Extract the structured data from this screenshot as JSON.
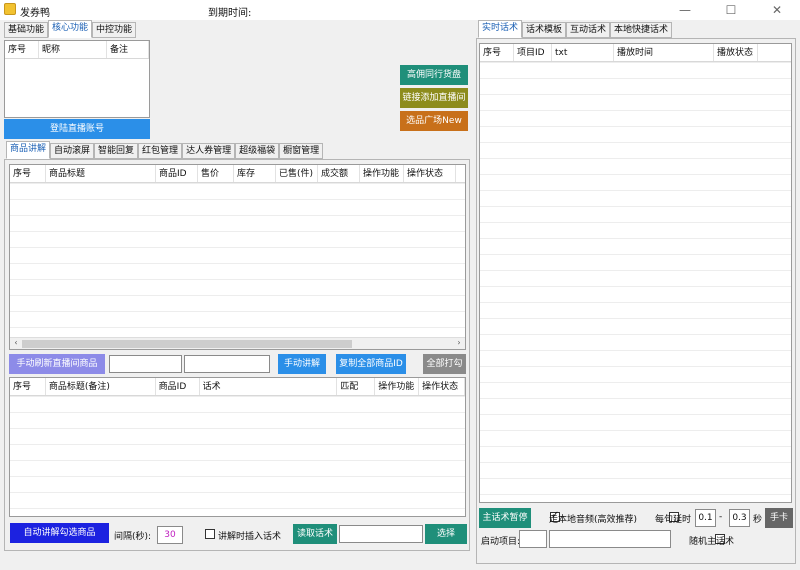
{
  "window": {
    "title": "发券鸭",
    "expire_label": "到期时间:"
  },
  "left_top_tabs": [
    "基础功能",
    "核心功能",
    "中控功能"
  ],
  "account_table": {
    "columns": [
      "序号",
      "昵称",
      "备注"
    ]
  },
  "login_button": "登陆直播账号",
  "side_buttons": {
    "b1": "高佣同行货盘",
    "b2": "链接添加直播间",
    "b3": "选品广场New"
  },
  "feature_tabs": [
    "商品讲解",
    "自动滚屏",
    "智能回复",
    "红包管理",
    "达人券管理",
    "超级福袋",
    "橱窗管理"
  ],
  "product_table": {
    "columns": [
      "序号",
      "商品标题",
      "商品ID",
      "售价",
      "库存",
      "已售(件)",
      "成交额",
      "操作功能",
      "操作状态"
    ]
  },
  "mid_controls": {
    "refresh": "手动刷新直播间商品",
    "input1": "",
    "input2": "",
    "manual_explain": "手动讲解",
    "copy_ids": "复制全部商品ID",
    "print_all": "全部打勾"
  },
  "script_table": {
    "columns": [
      "序号",
      "商品标题(备注)",
      "商品ID",
      "话术",
      "匹配",
      "操作功能",
      "操作状态"
    ]
  },
  "bottom_controls": {
    "auto_explain": "自动讲解勾选商品",
    "interval_label": "间隔(秒):",
    "interval_value": "30",
    "insert_label": "讲解时插入话术",
    "read_script": "读取话术",
    "read_input": "",
    "select": "选择"
  },
  "right_tabs": [
    "实时话术",
    "话术模板",
    "互动话术",
    "本地快捷话术"
  ],
  "right_table": {
    "columns": [
      "序号",
      "项目ID",
      "txt",
      "播放时间",
      "播放状态"
    ]
  },
  "right_controls": {
    "pause": "主话术暂停",
    "local_audio": "走本地音频(高效推荐)",
    "delay": "每句延时",
    "delay_min": "0.1",
    "dash": "-",
    "delay_max": "0.3",
    "sec": "秒",
    "card": "手卡",
    "start_item": "启动项目:",
    "start_input1": "",
    "start_input2": "",
    "random": "随机主话术"
  },
  "colors": {
    "accent_blue": "#2b8fe8",
    "teal": "#1f8f7a",
    "olive": "#8d8c1c",
    "orange": "#c8701a",
    "dark_blue": "#1c22e0",
    "gray_btn": "#8a8a8a",
    "purple_btn": "#8d8be8"
  }
}
